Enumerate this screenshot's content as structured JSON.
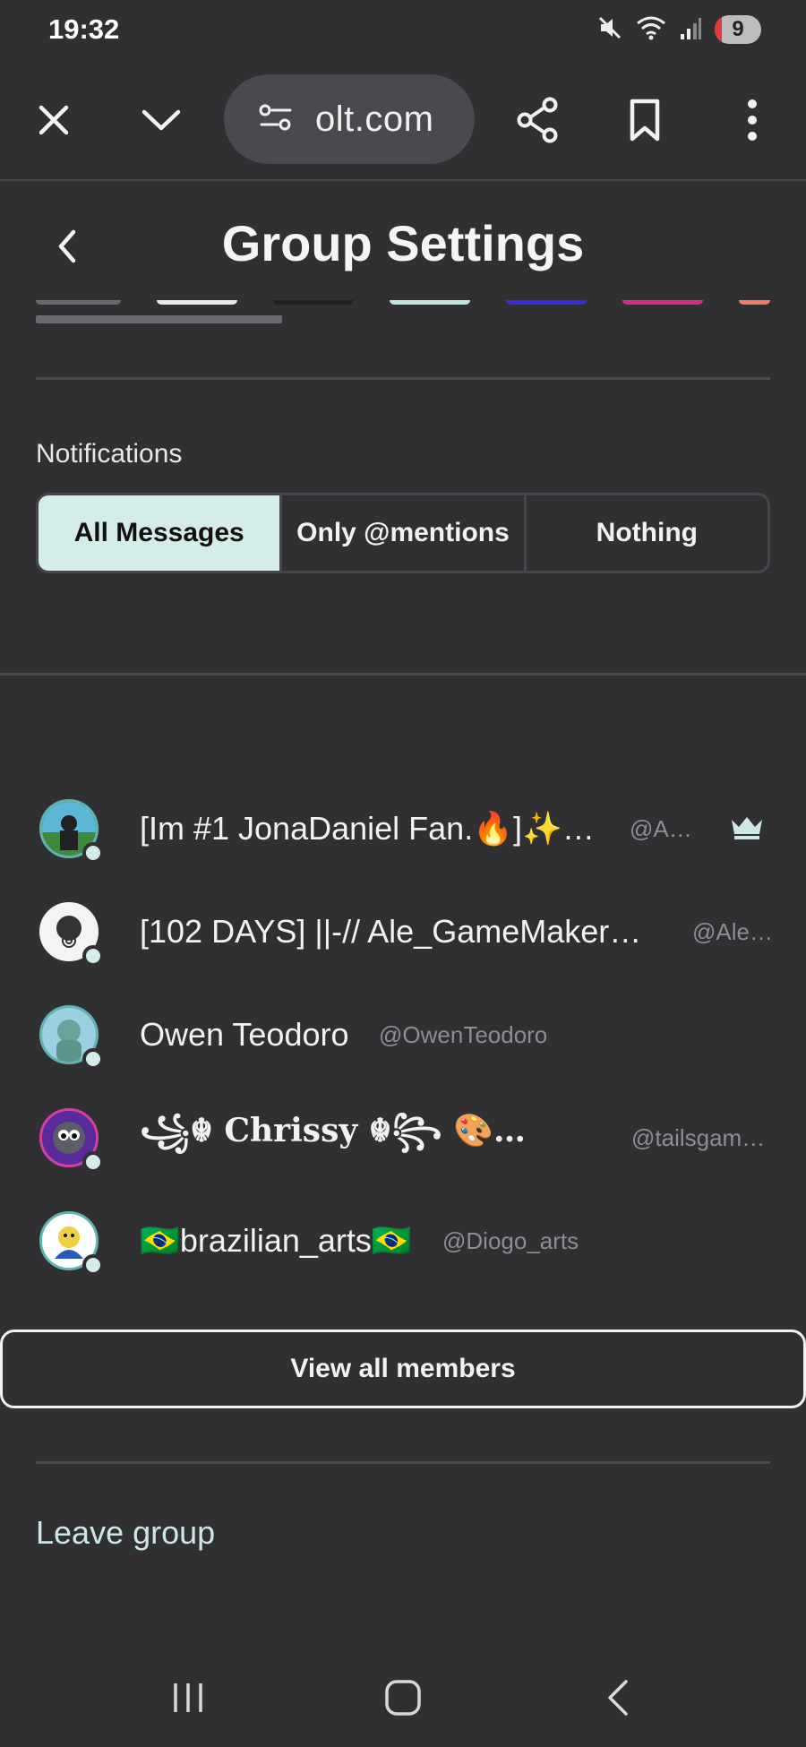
{
  "status_bar": {
    "time": "19:32",
    "icons": [
      "mute-icon",
      "wifi-icon",
      "signal-icon"
    ],
    "battery_badge": "9"
  },
  "browser": {
    "url_fragment": "olt.com",
    "buttons": [
      "close-icon",
      "chevron-down-icon",
      "site-settings-icon",
      "share-icon",
      "bookmark-icon",
      "more-icon"
    ]
  },
  "header": {
    "title": "Group Settings",
    "back_icon": "chevron-left-icon"
  },
  "notifications": {
    "label": "Notifications",
    "options": [
      "All Messages",
      "Only @mentions",
      "Nothing"
    ],
    "selected": "All Messages"
  },
  "members": [
    {
      "name": "[Im #1 JonaDaniel Fan.🔥]✨…",
      "handle": "@A…",
      "owner": true,
      "avatar_color": "#2f6f66"
    },
    {
      "name": "[102 DAYS] ||-// Ale_GameMaker…",
      "handle": "@Ale…",
      "owner": false,
      "avatar_color": "#e8e8e8"
    },
    {
      "name": "Owen Teodoro",
      "handle": "@OwenTeodoro",
      "owner": false,
      "avatar_color": "#6aa39a"
    },
    {
      "name": "꧁☬ Chrissy ☬꧂ 🎨…",
      "handle": "@tailsgam…",
      "owner": false,
      "avatar_color": "#8a2fb5"
    },
    {
      "name": "🇧🇷brazilian_arts🇧🇷",
      "handle": "@Diogo_arts",
      "owner": false,
      "avatar_color": "#f0d040"
    }
  ],
  "actions": {
    "view_all": "View all members",
    "leave": "Leave group"
  },
  "colors": {
    "background": "#303033",
    "accent": "#d5ede8",
    "handle": "#8d8d92"
  },
  "nav": [
    "recent-apps-icon",
    "home-icon",
    "back-icon"
  ]
}
